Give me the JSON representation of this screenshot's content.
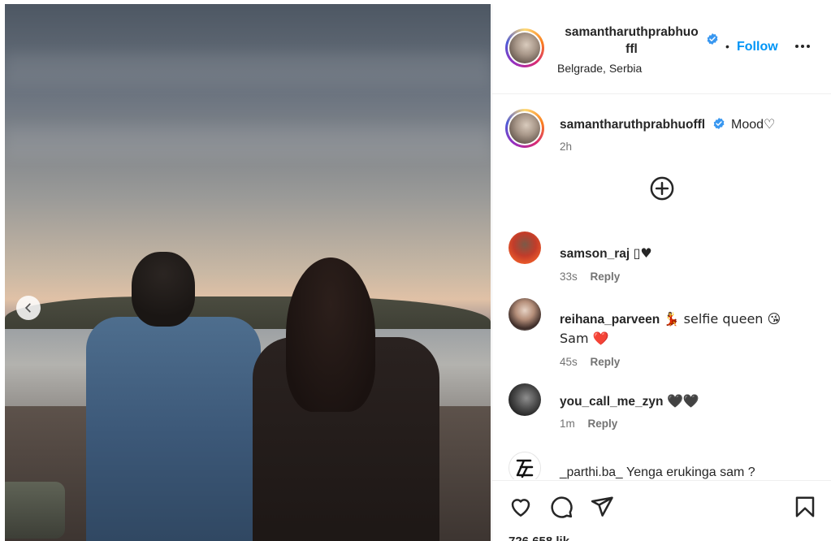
{
  "post": {
    "username_line1": "samantharuthprabhuo",
    "username_line2": "ffl",
    "follow_separator": "•",
    "follow_label": "Follow",
    "location": "Belgrade, Serbia"
  },
  "caption": {
    "username": "samantharuthprabhuoffl",
    "text": "Mood♡",
    "time": "2h"
  },
  "comments": [
    {
      "username": "samson_raj",
      "text": "▯♥",
      "time": "33s",
      "reply_label": "Reply"
    },
    {
      "username": "reihana_parveen",
      "text": "💃 selfie queen 😘",
      "text_line2": "Sam ❤️",
      "time": "45s",
      "reply_label": "Reply"
    },
    {
      "username": "you_call_me_zyn",
      "text": "🖤🖤",
      "time": "1m",
      "reply_label": "Reply"
    },
    {
      "username": "_parthi.ba_",
      "text": "Yenga erukinga sam ?"
    }
  ],
  "likes": {
    "text": "726,658 lik"
  },
  "icons": {
    "prev": "chevron-left-icon",
    "verified": "verified-badge-icon",
    "more": "more-horizontal-icon",
    "load_more": "plus-circle-icon",
    "like": "heart-icon",
    "comment": "comment-icon",
    "share": "send-icon",
    "save": "bookmark-icon"
  },
  "colors": {
    "follow": "#0095f6",
    "verified": "#3897f0",
    "muted": "#737373",
    "heart": "#e0245e"
  }
}
